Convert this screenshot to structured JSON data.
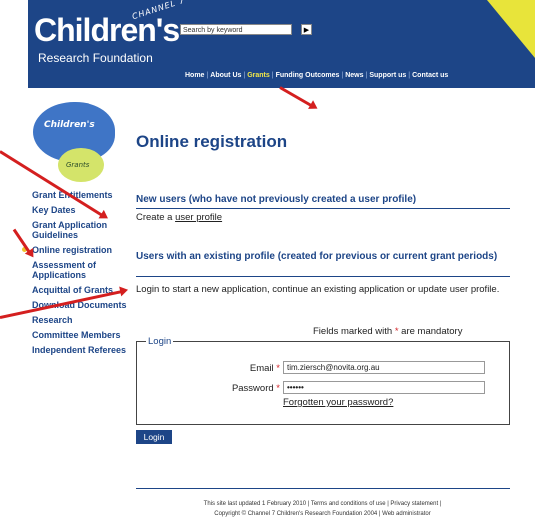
{
  "header": {
    "brand_channel": "CHANNEL 7",
    "brand_main": "Children's",
    "brand_sub": "Research Foundation",
    "search_placeholder": "Search by keyword",
    "search_go": "▶",
    "nav": [
      "Home",
      "About Us",
      "Grants",
      "Funding Outcomes",
      "News",
      "Support us",
      "Contact us"
    ],
    "nav_active": "Grants"
  },
  "decor": {
    "pig_blue_text": "Children's",
    "pig_green_text": "Grants"
  },
  "page": {
    "title": "Online registration"
  },
  "sidebar": {
    "items": [
      "Grant Entitlements",
      "Key Dates",
      "Grant Application Guidelines",
      "Online registration",
      "Assessment of Applications",
      "Acquittal of Grants",
      "Download Documents",
      "Research",
      "Committee Members",
      "Independent Referees"
    ],
    "current": "Online registration"
  },
  "new_users": {
    "heading": "New users (who have not previously created a user profile)",
    "text_prefix": "Create a ",
    "link": "user profile"
  },
  "existing": {
    "heading": "Users with an existing profile (created for previous or current grant periods)",
    "text": "Login to start a new application, continue an existing application or update user profile."
  },
  "form": {
    "mandatory_prefix": "Fields marked with ",
    "mandatory_star": "*",
    "mandatory_suffix": " are mandatory",
    "legend": "Login",
    "email_label": "Email",
    "email_value": "tim.ziersch@novita.org.au",
    "password_label": "Password",
    "password_value": "••••••",
    "required_star": "*",
    "forgot": "Forgotten your password?",
    "submit": "Login"
  },
  "footer": {
    "line1": "This site last updated 1 February 2010 | Terms and conditions of use | Privacy statement |",
    "line2": "Copyright © Channel 7 Children's Research Foundation 2004 | Web administrator"
  },
  "colors": {
    "brand_blue": "#1d4587",
    "accent_yellow": "#e8e43a",
    "annotation_red": "#d41f1f",
    "required_red": "#d3272b"
  }
}
